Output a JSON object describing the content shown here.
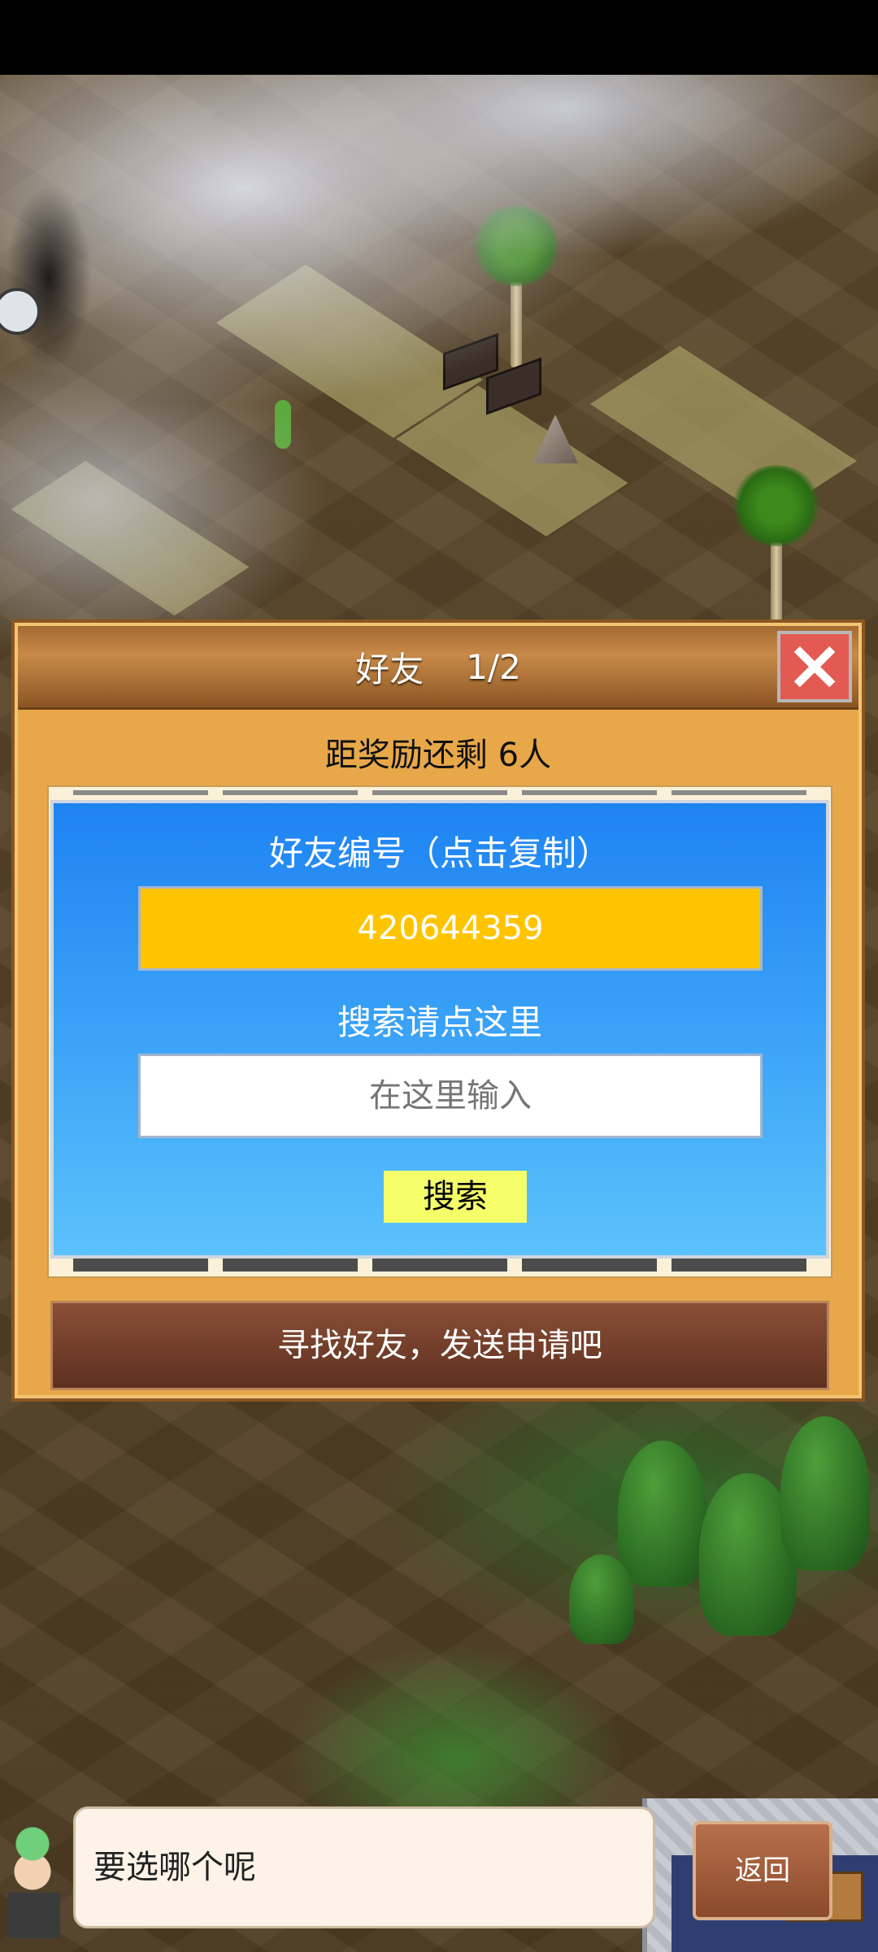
{
  "dialog": {
    "title": "好友",
    "page": "1/2",
    "reward_text": "距奖励还剩 6人",
    "friend_id_label": "好友编号（点击复制）",
    "friend_id": "420644359",
    "search_label": "搜索请点这里",
    "search_placeholder": "在这里输入",
    "search_button": "搜索",
    "find_button": "寻找好友，发送申请吧",
    "close_icon": "close-icon"
  },
  "bottom": {
    "speech": "要选哪个呢",
    "back_button": "返回"
  },
  "colors": {
    "dialog_bg": "#e8a849",
    "panel_blue": "#1e83f2",
    "id_box": "#ffc400",
    "search_button": "#f4ff6a",
    "close_button": "#e25a52",
    "arrow": "#c9df2a"
  }
}
